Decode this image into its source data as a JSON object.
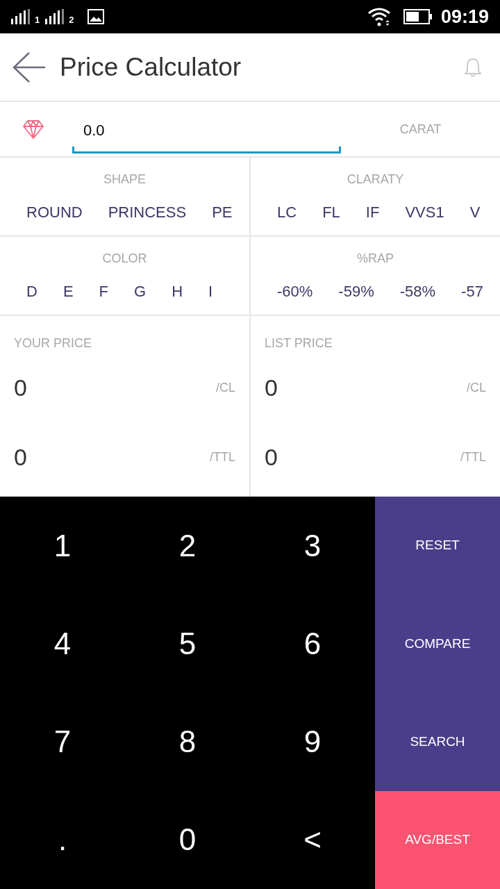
{
  "status_bar": {
    "sim_labels": [
      "1",
      "2"
    ],
    "time": "09:19"
  },
  "header": {
    "title": "Price Calculator"
  },
  "carat": {
    "value": "0.0",
    "label": "CARAT"
  },
  "selectors": [
    {
      "label": "SHAPE",
      "options": [
        "ROUND",
        "PRINCESS",
        "PE"
      ]
    },
    {
      "label": "CLARATY",
      "options": [
        "LC",
        "FL",
        "IF",
        "VVS1",
        "V"
      ]
    },
    {
      "label": "COLOR",
      "options": [
        "D",
        "E",
        "F",
        "G",
        "H",
        "I"
      ]
    },
    {
      "label": "%RAP",
      "options": [
        "-60%",
        "-59%",
        "-58%",
        "-57"
      ]
    }
  ],
  "prices": [
    {
      "label": "YOUR PRICE",
      "rows": [
        {
          "value": "0",
          "unit": "/CL"
        },
        {
          "value": "0",
          "unit": "/TTL"
        }
      ]
    },
    {
      "label": "LIST PRICE",
      "rows": [
        {
          "value": "0",
          "unit": "/CL"
        },
        {
          "value": "0",
          "unit": "/TTL"
        }
      ]
    }
  ],
  "keypad": {
    "keys": [
      "1",
      "2",
      "3",
      "4",
      "5",
      "6",
      "7",
      "8",
      "9",
      ".",
      "0",
      "<"
    ],
    "actions": [
      {
        "label": "RESET",
        "kind": "normal"
      },
      {
        "label": "COMPARE",
        "kind": "normal"
      },
      {
        "label": "SEARCH",
        "kind": "normal"
      },
      {
        "label": "AVG/BEST",
        "kind": "accent"
      }
    ]
  }
}
